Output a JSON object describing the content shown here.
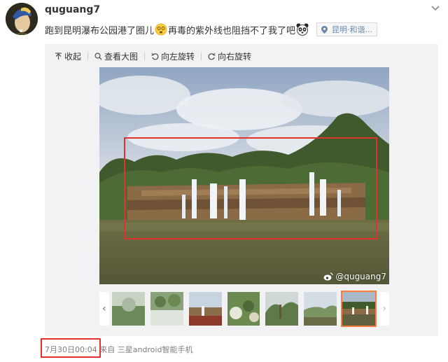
{
  "post": {
    "username": "quguang7",
    "text_part1": "跑到昆明瀑布公园港了圈儿",
    "text_part2": "再毒的紫外线也阻挡不了我了吧",
    "location": "昆明·和谐...",
    "emoji1": "dizzy-face-emoji",
    "emoji2": "panda-face-emoji"
  },
  "toolbar": {
    "collapse": "收起",
    "view_large": "查看大图",
    "rotate_left": "向左旋转",
    "rotate_right": "向右旋转"
  },
  "photo": {
    "watermark": "@quguang7"
  },
  "thumbnails": {
    "count": 7,
    "selected_index": 6,
    "prev_icon": "‹",
    "next_icon": "›"
  },
  "meta": {
    "date": "7月30日",
    "time": "00:04",
    "from_label": "来自",
    "app": "三星android智能手机"
  },
  "colors": {
    "highlight": "#e0332e",
    "selected_thumb": "#fa7d3c",
    "link": "#6a87ae"
  }
}
